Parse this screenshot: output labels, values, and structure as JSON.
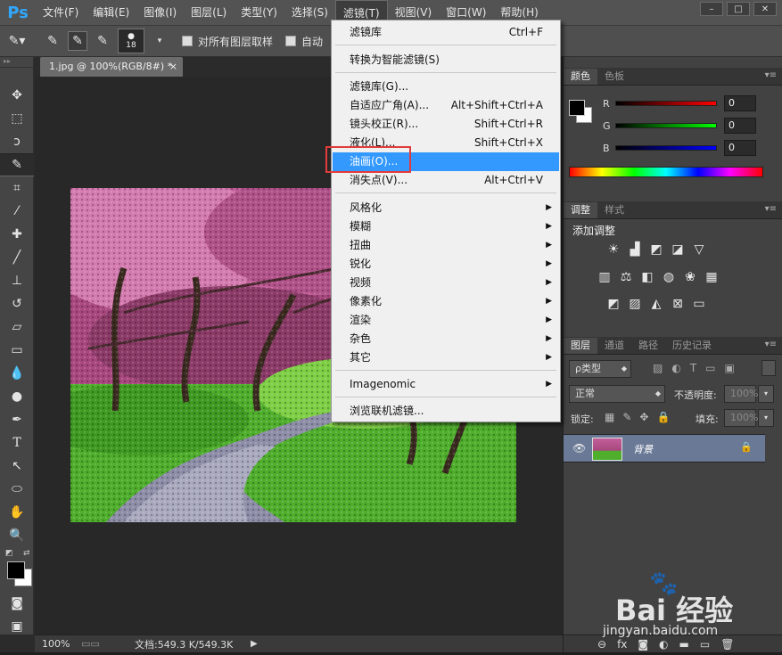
{
  "app": {
    "logo": "Ps"
  },
  "menubar": {
    "items": [
      "文件(F)",
      "编辑(E)",
      "图像(I)",
      "图层(L)",
      "类型(Y)",
      "选择(S)",
      "滤镜(T)",
      "视图(V)",
      "窗口(W)",
      "帮助(H)"
    ],
    "active_index": 6
  },
  "window_controls": [
    "–",
    "□",
    "✕"
  ],
  "options_bar": {
    "brush_size": "18",
    "sample_all_layers": "对所有图层取样",
    "auto_enhance": "自动"
  },
  "document": {
    "tab_title": "1.jpg @ 100%(RGB/8#) *",
    "close": "×"
  },
  "status": {
    "zoom": "100%",
    "doc_info": "文档:549.3 K/549.3K"
  },
  "filter_menu": {
    "items": [
      {
        "label": "滤镜库",
        "shortcut": "Ctrl+F"
      },
      {
        "label": "转换为智能滤镜(S)",
        "shortcut": ""
      },
      {
        "label": "滤镜库(G)...",
        "shortcut": ""
      },
      {
        "label": "自适应广角(A)...",
        "shortcut": "Alt+Shift+Ctrl+A"
      },
      {
        "label": "镜头校正(R)...",
        "shortcut": "Shift+Ctrl+R"
      },
      {
        "label": "液化(L)...",
        "shortcut": "Shift+Ctrl+X"
      },
      {
        "label": "油画(O)...",
        "shortcut": ""
      },
      {
        "label": "消失点(V)...",
        "shortcut": "Alt+Ctrl+V"
      },
      {
        "label": "风格化",
        "shortcut": ""
      },
      {
        "label": "模糊",
        "shortcut": ""
      },
      {
        "label": "扭曲",
        "shortcut": ""
      },
      {
        "label": "锐化",
        "shortcut": ""
      },
      {
        "label": "视频",
        "shortcut": ""
      },
      {
        "label": "像素化",
        "shortcut": ""
      },
      {
        "label": "渲染",
        "shortcut": ""
      },
      {
        "label": "杂色",
        "shortcut": ""
      },
      {
        "label": "其它",
        "shortcut": ""
      },
      {
        "label": "Imagenomic",
        "shortcut": ""
      },
      {
        "label": "浏览联机滤镜...",
        "shortcut": ""
      }
    ],
    "highlighted_index": 6
  },
  "color_panel": {
    "tabs": [
      "颜色",
      "色板"
    ],
    "channels": [
      {
        "label": "R",
        "value": "0"
      },
      {
        "label": "G",
        "value": "0"
      },
      {
        "label": "B",
        "value": "0"
      }
    ]
  },
  "adjust_panel": {
    "tabs": [
      "调整",
      "样式"
    ],
    "heading": "添加调整"
  },
  "layers_panel": {
    "tabs": [
      "图层",
      "通道",
      "路径",
      "历史记录"
    ],
    "kind_filter": "ρ类型",
    "blend_mode": "正常",
    "opacity_label": "不透明度:",
    "opacity_value": "100%",
    "lock_label": "锁定:",
    "fill_label": "填充:",
    "fill_value": "100%",
    "layer_name": "背景"
  },
  "watermark": {
    "logo": "Bai 经验",
    "url": "jingyan.baidu.com"
  },
  "colors": {
    "menu_highlight": "#3399ff",
    "annotation_red": "#e23b3b",
    "ps_blue": "#30a8ff"
  }
}
